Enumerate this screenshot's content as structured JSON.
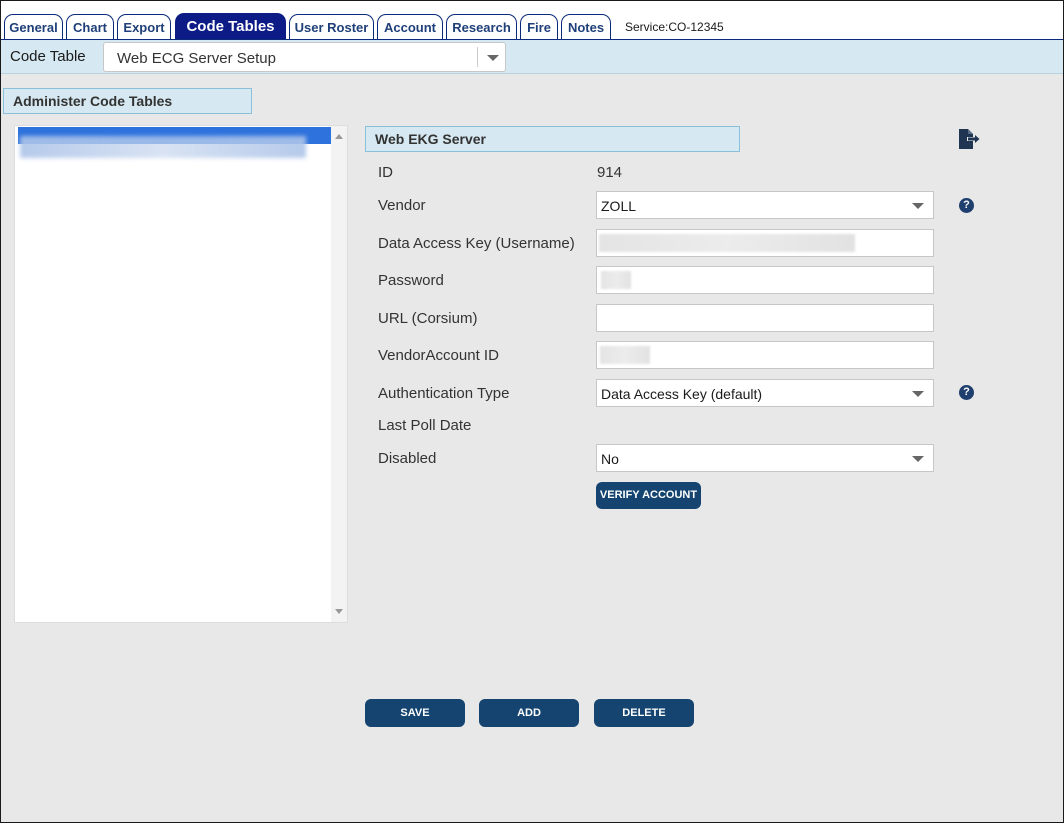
{
  "tabs": [
    {
      "label": "General"
    },
    {
      "label": "Chart"
    },
    {
      "label": "Export"
    },
    {
      "label": "Code Tables"
    },
    {
      "label": "User Roster"
    },
    {
      "label": "Account"
    },
    {
      "label": "Research"
    },
    {
      "label": "Fire"
    },
    {
      "label": "Notes"
    }
  ],
  "active_tab": "Code Tables",
  "service": "Service:CO-12345",
  "code_table": {
    "label": "Code Table",
    "selected": "Web ECG Server Setup"
  },
  "admin_header": "Administer Code Tables",
  "form": {
    "header": "Web EKG Server",
    "id_label": "ID",
    "id_value": "914",
    "vendor_label": "Vendor",
    "vendor_value": "ZOLL",
    "data_access_key_label": "Data Access Key (Username)",
    "password_label": "Password",
    "url_label": "URL (Corsium)",
    "url_value": "",
    "vendor_account_label": "VendorAccount ID",
    "auth_type_label": "Authentication Type",
    "auth_type_value": "Data Access Key (default)",
    "last_poll_label": "Last Poll Date",
    "disabled_label": "Disabled",
    "disabled_value": "No",
    "verify_button": "VERIFY ACCOUNT",
    "help_glyph": "?"
  },
  "actions": {
    "save": "SAVE",
    "add": "ADD",
    "delete": "DELETE"
  },
  "icons": {
    "export": "file-export-icon",
    "help": "question-circle-icon",
    "dropdown": "caret-down-icon"
  },
  "colors": {
    "active_tab": "#0d1b86",
    "tab_text": "#1f3f79",
    "header_bg": "#d6e8f1",
    "button_bg": "#14446f",
    "list_selection": "#2e72dd"
  }
}
